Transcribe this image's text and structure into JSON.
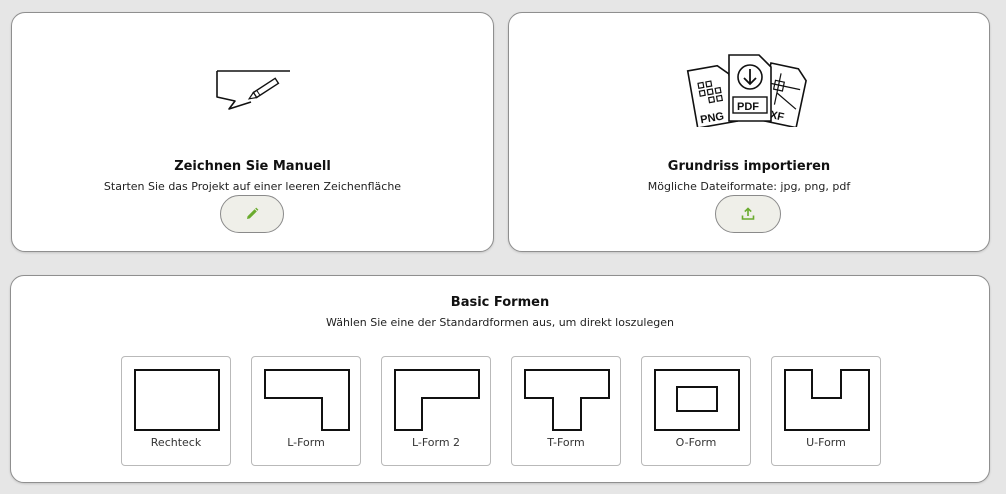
{
  "manual": {
    "title": "Zeichnen Sie Manuell",
    "subtitle": "Starten Sie das Projekt auf einer leeren Zeichenfläche",
    "hero_icon": "drawing-sheet-with-pencil-icon",
    "button_icon": "pencil-icon"
  },
  "import": {
    "title": "Grundriss importieren",
    "subtitle": "Mögliche Dateiformate: jpg, png, pdf",
    "hero_icon": "file-formats-icon",
    "file_labels": [
      "PNG",
      "PDF",
      "DXF"
    ],
    "button_icon": "upload-icon"
  },
  "basic": {
    "title": "Basic Formen",
    "subtitle": "Wählen Sie eine der Standardformen aus, um direkt loszulegen",
    "shapes": [
      {
        "label": "Rechteck"
      },
      {
        "label": "L-Form"
      },
      {
        "label": "L-Form 2"
      },
      {
        "label": "T-Form"
      },
      {
        "label": "O-Form"
      },
      {
        "label": "U-Form"
      }
    ]
  },
  "colors": {
    "accent": "#6aab2e",
    "background": "#e6e6e6",
    "button_bg": "#efefe9"
  }
}
